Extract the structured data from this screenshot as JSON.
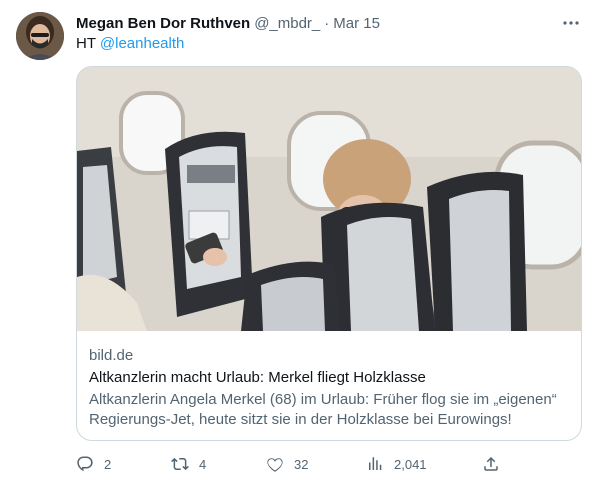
{
  "tweet": {
    "display_name": "Megan Ben Dor Ruthven",
    "handle": "@_mbdr_",
    "separator": "·",
    "time": "Mar 15",
    "text_prefix": "HT ",
    "mention": "@leanhealth"
  },
  "card": {
    "domain": "bild.de",
    "title": "Altkanzlerin macht Urlaub: Merkel fliegt Holzklasse",
    "description": "Altkanzlerin Angela Merkel (68) im Urlaub: Früher flog sie im „eigenen“ Regierungs-Jet, heute sitzt sie in der Holzklasse bei Eurowings!"
  },
  "actions": {
    "replies": "2",
    "retweets": "4",
    "likes": "32",
    "views": "2,041"
  },
  "colors": {
    "accent": "#1d9bf0",
    "secondary_text": "#536471",
    "border": "#cfd9de"
  },
  "icons": [
    "more-icon",
    "reply-icon",
    "retweet-icon",
    "like-icon",
    "views-icon",
    "share-icon"
  ]
}
